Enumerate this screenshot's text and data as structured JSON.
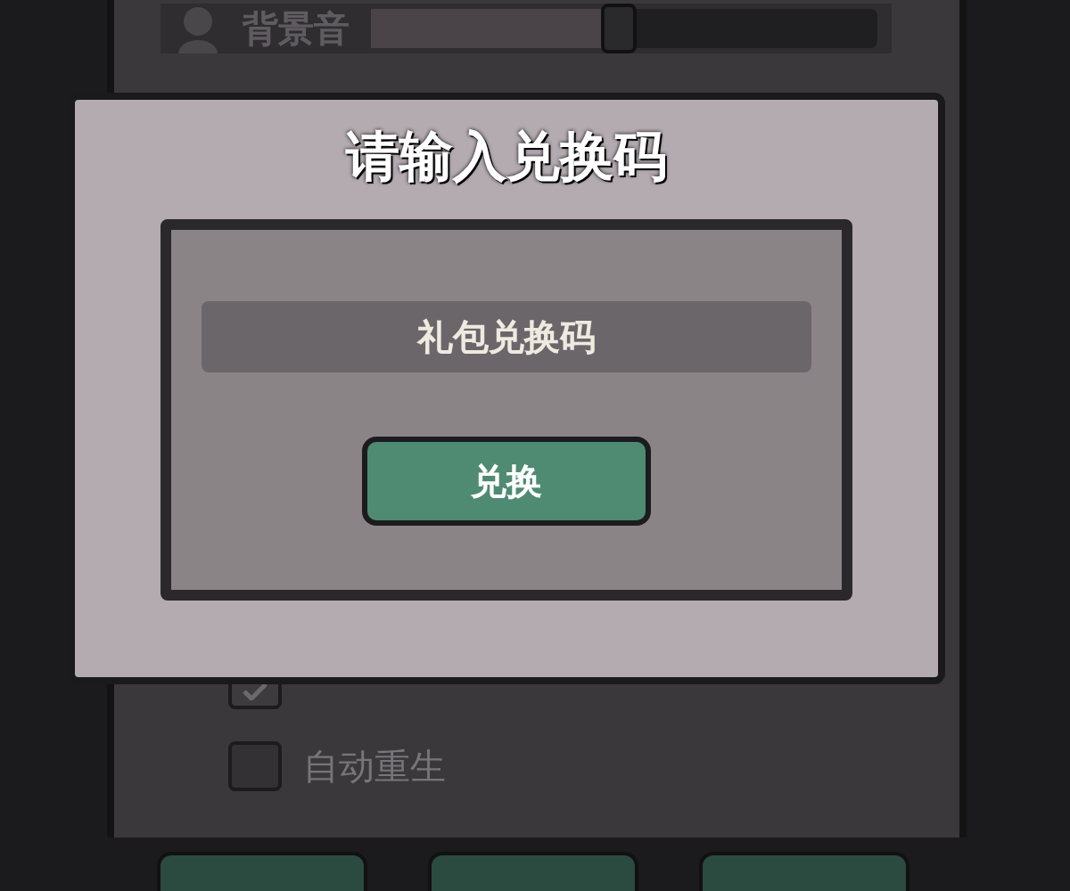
{
  "background_settings": {
    "sound_row": {
      "label": "背景音",
      "level": 0.49
    },
    "options": [
      {
        "checked": true
      },
      {
        "label": "自动重生",
        "checked": false
      }
    ]
  },
  "dialog": {
    "title": "请输入兑换码",
    "code_field": {
      "placeholder": "礼包兑换码"
    },
    "submit_button": "兑换"
  }
}
